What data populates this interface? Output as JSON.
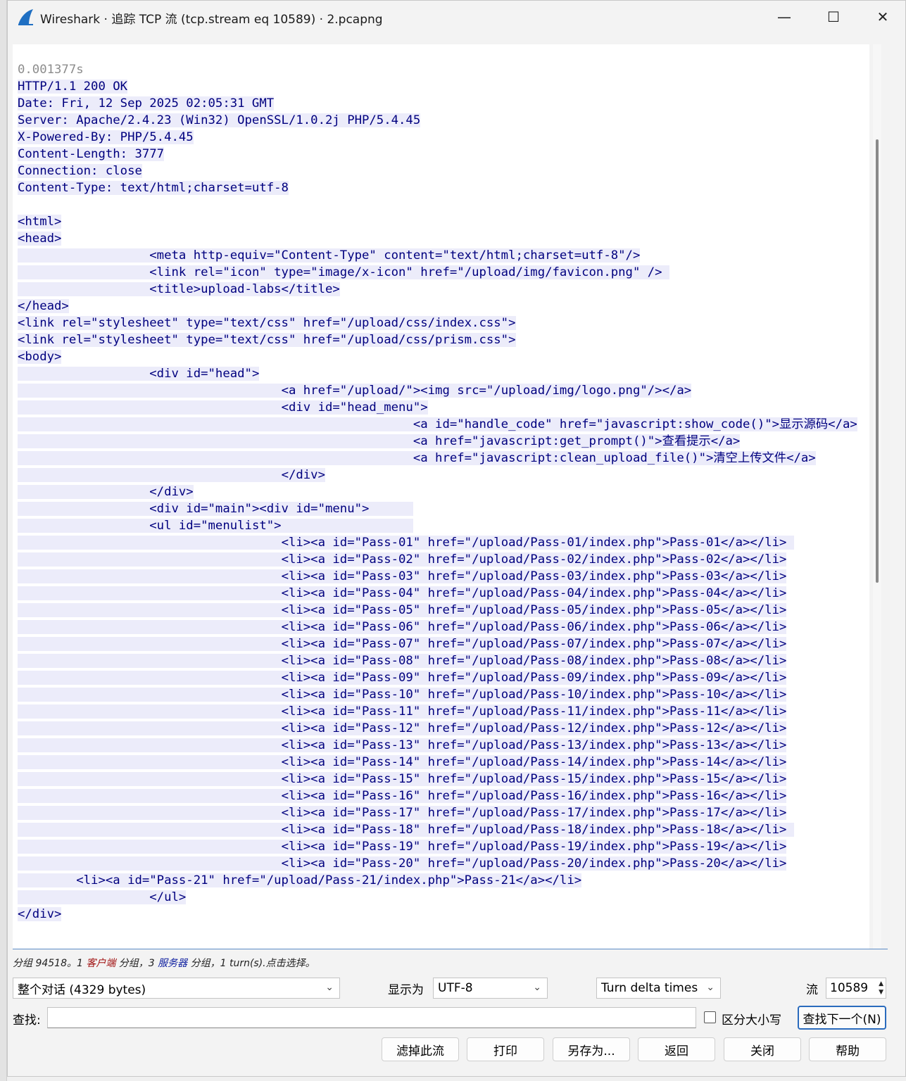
{
  "window": {
    "title": "Wireshark · 追踪 TCP 流 (tcp.stream eq 10589) · 2.pcapng",
    "minimize_glyph": "—",
    "maximize_glyph": "☐",
    "close_glyph": "✕",
    "app_icon": "wireshark-fin-icon"
  },
  "stream": {
    "lines": [
      "0.001377s",
      "HTTP/1.1 200 OK",
      "Date: Fri, 12 Sep 2025 02:05:31 GMT",
      "Server: Apache/2.4.23 (Win32) OpenSSL/1.0.2j PHP/5.4.45",
      "X-Powered-By: PHP/5.4.45",
      "Content-Length: 3777",
      "Connection: close",
      "Content-Type: text/html;charset=utf-8",
      "",
      "<html>",
      "<head>",
      "\t\t\t<meta http-equiv=\"Content-Type\" content=\"text/html;charset=utf-8\"/>",
      "\t\t\t<link rel=\"icon\" type=\"image/x-icon\" href=\"/upload/img/favicon.png\" /> ",
      "\t\t\t<title>upload-labs</title>",
      "</head>",
      "<link rel=\"stylesheet\" type=\"text/css\" href=\"/upload/css/index.css\">",
      "<link rel=\"stylesheet\" type=\"text/css\" href=\"/upload/css/prism.css\">",
      "<body>",
      "\t\t\t<div id=\"head\">",
      "\t\t\t\t\t\t<a href=\"/upload/\"><img src=\"/upload/img/logo.png\"/></a>",
      "\t\t\t\t\t\t<div id=\"head_menu\">",
      "\t\t\t\t\t\t\t\t\t<a id=\"handle_code\" href=\"javascript:show_code()\">显示源码</a>",
      "\t\t\t\t\t\t\t\t\t<a href=\"javascript:get_prompt()\">查看提示</a>",
      "\t\t\t\t\t\t\t\t\t<a href=\"javascript:clean_upload_file()\">清空上传文件</a>",
      "\t\t\t\t\t\t</div>",
      "\t\t\t</div>",
      "\t\t\t<div id=\"main\"><div id=\"menu\">\t",
      "\t\t\t<ul id=\"menulist\">\t\t\t",
      "\t\t\t\t\t\t<li><a id=\"Pass-01\" href=\"/upload/Pass-01/index.php\">Pass-01</a></li> ",
      "\t\t\t\t\t\t<li><a id=\"Pass-02\" href=\"/upload/Pass-02/index.php\">Pass-02</a></li>",
      "\t\t\t\t\t\t<li><a id=\"Pass-03\" href=\"/upload/Pass-03/index.php\">Pass-03</a></li>",
      "\t\t\t\t\t\t<li><a id=\"Pass-04\" href=\"/upload/Pass-04/index.php\">Pass-04</a></li>",
      "\t\t\t\t\t\t<li><a id=\"Pass-05\" href=\"/upload/Pass-05/index.php\">Pass-05</a></li>",
      "\t\t\t\t\t\t<li><a id=\"Pass-06\" href=\"/upload/Pass-06/index.php\">Pass-06</a></li>",
      "\t\t\t\t\t\t<li><a id=\"Pass-07\" href=\"/upload/Pass-07/index.php\">Pass-07</a></li>",
      "\t\t\t\t\t\t<li><a id=\"Pass-08\" href=\"/upload/Pass-08/index.php\">Pass-08</a></li>",
      "\t\t\t\t\t\t<li><a id=\"Pass-09\" href=\"/upload/Pass-09/index.php\">Pass-09</a></li>",
      "\t\t\t\t\t\t<li><a id=\"Pass-10\" href=\"/upload/Pass-10/index.php\">Pass-10</a></li>",
      "\t\t\t\t\t\t<li><a id=\"Pass-11\" href=\"/upload/Pass-11/index.php\">Pass-11</a></li>",
      "\t\t\t\t\t\t<li><a id=\"Pass-12\" href=\"/upload/Pass-12/index.php\">Pass-12</a></li>",
      "\t\t\t\t\t\t<li><a id=\"Pass-13\" href=\"/upload/Pass-13/index.php\">Pass-13</a></li>",
      "\t\t\t\t\t\t<li><a id=\"Pass-14\" href=\"/upload/Pass-14/index.php\">Pass-14</a></li>",
      "\t\t\t\t\t\t<li><a id=\"Pass-15\" href=\"/upload/Pass-15/index.php\">Pass-15</a></li>",
      "\t\t\t\t\t\t<li><a id=\"Pass-16\" href=\"/upload/Pass-16/index.php\">Pass-16</a></li>",
      "\t\t\t\t\t\t<li><a id=\"Pass-17\" href=\"/upload/Pass-17/index.php\">Pass-17</a></li>",
      "\t\t\t\t\t\t<li><a id=\"Pass-18\" href=\"/upload/Pass-18/index.php\">Pass-18</a></li> ",
      "\t\t\t\t\t\t<li><a id=\"Pass-19\" href=\"/upload/Pass-19/index.php\">Pass-19</a></li>",
      "\t\t\t\t\t\t<li><a id=\"Pass-20\" href=\"/upload/Pass-20/index.php\">Pass-20</a></li>",
      "        <li><a id=\"Pass-21\" href=\"/upload/Pass-21/index.php\">Pass-21</a></li>",
      "\t\t\t</ul>",
      "</div>"
    ]
  },
  "status": {
    "prefix": "分组 94518。1 ",
    "client_word": "客户端",
    "middle": " 分组，3 ",
    "server_word": "服务器",
    "suffix": " 分组，1 turn(s).点击选择。"
  },
  "controls": {
    "conversation_value": "整个对话 (4329 bytes)",
    "display_label": "显示为",
    "encoding_value": "UTF-8",
    "delta_value": "Turn delta times",
    "stream_label": "流",
    "stream_value": "10589",
    "find_label": "查找:",
    "find_value": "",
    "case_label": "区分大小写",
    "find_next_label": "查找下一个(N)"
  },
  "buttons": {
    "filter_out": "滤掉此流",
    "print": "打印",
    "save_as": "另存为...",
    "back": "返回",
    "close": "关闭",
    "help": "帮助"
  },
  "colors": {
    "server_text": "#00007f",
    "server_bg": "#ececfa",
    "focus_border": "#2a6bbd"
  }
}
